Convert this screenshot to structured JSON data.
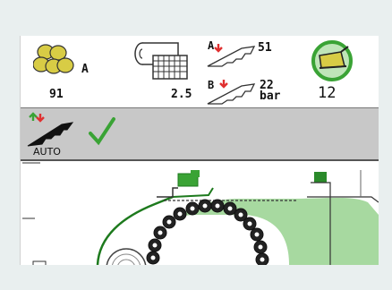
{
  "status": {
    "bale_count": {
      "icon": "bales-icon",
      "suffix": "A",
      "value": "91"
    },
    "net_wrap": {
      "icon": "net-roll-icon",
      "value": "2.5"
    },
    "knife_a": {
      "icon": "knife-pressure-icon",
      "label": "A",
      "value": "51"
    },
    "knife_b": {
      "icon": "knife-pressure-icon",
      "label": "B",
      "value": "22",
      "unit": "bar"
    },
    "baler": {
      "icon": "baler-chamber-icon",
      "value": "12"
    }
  },
  "auto_control": {
    "icon": "knife-auto-icon",
    "label": "AUTO",
    "check_icon": "checkmark-icon"
  },
  "machine_view": {
    "icon": "baler-chamber-diagram"
  },
  "colors": {
    "green": "#3aa335",
    "dark_green": "#1d7a1d",
    "light_green": "#a7d9a0",
    "red": "#e03030",
    "panel_gray": "#c8c8c8",
    "bale_yellow": "#d8cc45"
  }
}
